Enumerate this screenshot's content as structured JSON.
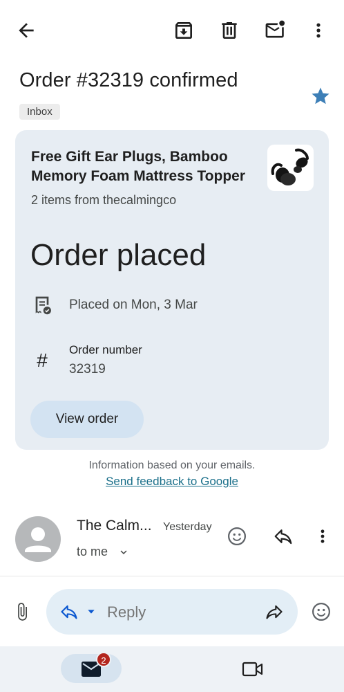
{
  "subject": "Order #32319 confirmed",
  "label": "Inbox",
  "card": {
    "product_title": "Free Gift Ear Plugs, Bamboo Memory Foam Mattress Topper",
    "product_subtitle": "2 items from thecalmingco",
    "status": "Order placed",
    "placed_text": "Placed on Mon, 3 Mar",
    "order_number_label": "Order number",
    "order_number_value": "32319",
    "view_order_button": "View order"
  },
  "info_text": "Information based on your emails.",
  "feedback_link": "Send feedback to Google",
  "message": {
    "sender": "The Calm...",
    "time": "Yesterday",
    "recipient": "to me"
  },
  "reply_bar": {
    "placeholder": "Reply"
  },
  "bottom_nav": {
    "mail_badge": "2"
  },
  "colors": {
    "star": "#3d7fb7",
    "card_bg": "#e7edf3",
    "view_order_bg": "#d3e3f2",
    "badge": "#b3261e",
    "link": "#1a6f8a"
  },
  "icons": [
    "back-arrow-icon",
    "archive-icon",
    "delete-icon",
    "mark-unread-icon",
    "more-vert-icon",
    "star-icon",
    "receipt-icon",
    "hash-icon",
    "avatar-person-icon",
    "chevron-down-icon",
    "emoji-icon",
    "reply-icon",
    "attach-icon",
    "forward-icon",
    "mail-icon",
    "video-icon"
  ]
}
